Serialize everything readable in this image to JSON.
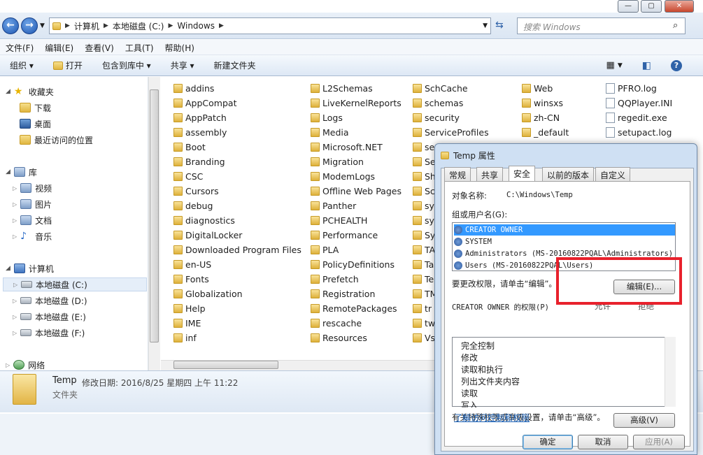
{
  "address": {
    "crumbs": [
      "计算机",
      "本地磁盘 (C:)",
      "Windows"
    ],
    "search_placeholder": "搜索 Windows"
  },
  "window_controls": {
    "min": "—",
    "max": "▢",
    "close": "✕"
  },
  "menu": [
    "文件(F)",
    "编辑(E)",
    "查看(V)",
    "工具(T)",
    "帮助(H)"
  ],
  "toolbar": {
    "organize": "组织 ▾",
    "open": "打开",
    "include": "包含到库中 ▾",
    "share": "共享 ▾",
    "new_folder": "新建文件夹"
  },
  "nav": {
    "favorites": "收藏夹",
    "downloads": "下载",
    "desktop": "桌面",
    "recent": "最近访问的位置",
    "libraries": "库",
    "videos": "视频",
    "pictures": "图片",
    "documents": "文档",
    "music": "音乐",
    "computer": "计算机",
    "drives": [
      "本地磁盘 (C:)",
      "本地磁盘 (D:)",
      "本地磁盘 (E:)",
      "本地磁盘 (F:)"
    ],
    "network": "网络"
  },
  "files": {
    "col1": [
      "addins",
      "AppCompat",
      "AppPatch",
      "assembly",
      "Boot",
      "Branding",
      "CSC",
      "Cursors",
      "debug",
      "diagnostics",
      "DigitalLocker",
      "Downloaded Program Files",
      "en-US",
      "Fonts",
      "Globalization",
      "Help",
      "IME",
      "inf"
    ],
    "col2": [
      "L2Schemas",
      "LiveKernelReports",
      "Logs",
      "Media",
      "Microsoft.NET",
      "Migration",
      "ModemLogs",
      "Offline Web Pages",
      "Panther",
      "PCHEALTH",
      "Performance",
      "PLA",
      "PolicyDefinitions",
      "Prefetch",
      "Registration",
      "RemotePackages",
      "rescache",
      "Resources"
    ],
    "col3": [
      "SchCache",
      "schemas",
      "security",
      "ServiceProfiles",
      "se",
      "Se",
      "Sh",
      "Sc",
      "sy",
      "sy",
      "Sy",
      "TA",
      "Ta",
      "Te",
      "TM",
      "tr",
      "tw",
      "Vs"
    ],
    "col4": [
      "Web",
      "winsxs",
      "zh-CN",
      "_default"
    ],
    "col5": [
      "PFRO.log",
      "QQPlayer.INI",
      "regedit.exe",
      "setupact.log"
    ]
  },
  "details": {
    "name": "Temp",
    "modified_label": "修改日期: 2016/8/25 星期四 上午 11:22",
    "type": "文件夹"
  },
  "dialog": {
    "title": "Temp 属性",
    "tabs": [
      "常规",
      "共享",
      "安全",
      "以前的版本",
      "自定义"
    ],
    "object_label": "对象名称:",
    "object_value": "C:\\Windows\\Temp",
    "group_label": "组或用户名(G):",
    "users": [
      "CREATOR OWNER",
      "SYSTEM",
      "Administrators (MS-20160822PQAL\\Administrators)",
      "Users (MS-20160822PQAL\\Users)"
    ],
    "change_hint": "要更改权限，请单击“编辑”。",
    "edit_button": "编辑(E)...",
    "perm_label": "CREATOR OWNER 的权限(P)",
    "allow": "允许",
    "deny": "拒绝",
    "permissions": [
      "完全控制",
      "修改",
      "读取和执行",
      "列出文件夹内容",
      "读取",
      "写入"
    ],
    "advanced_hint": "有关特殊权限或高级设置，请单击“高级”。",
    "advanced_button": "高级(V)",
    "link": "了解访问控制和权限",
    "ok": "确定",
    "cancel": "取消",
    "apply": "应用(A)"
  },
  "colors": {
    "highlight": "#3399ff",
    "annotation": "#e8212c",
    "link": "#1a5fb4"
  }
}
